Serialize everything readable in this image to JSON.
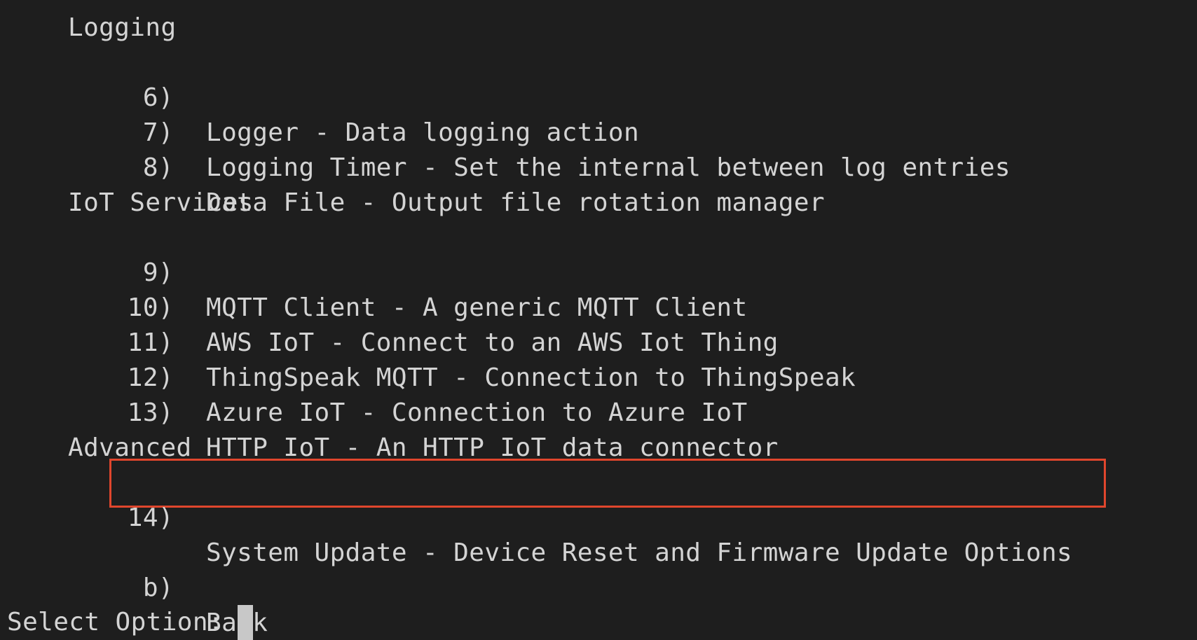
{
  "sections": {
    "logging": "Logging",
    "iot": "IoT Services",
    "advanced": "Advanced"
  },
  "options": [
    {
      "num": "6)",
      "label": "Logger - Data logging action"
    },
    {
      "num": "7)",
      "label": "Logging Timer - Set the internal between log entries"
    },
    {
      "num": "8)",
      "label": "Data File - Output file rotation manager"
    },
    {
      "num": "9)",
      "label": "MQTT Client - A generic MQTT Client"
    },
    {
      "num": "10)",
      "label": "AWS IoT - Connect to an AWS Iot Thing"
    },
    {
      "num": "11)",
      "label": "ThingSpeak MQTT - Connection to ThingSpeak"
    },
    {
      "num": "12)",
      "label": "Azure IoT - Connection to Azure IoT"
    },
    {
      "num": "13)",
      "label": "HTTP IoT - An HTTP IoT data connector"
    },
    {
      "num": "14)",
      "label": "System Update - Device Reset and Firmware Update Options"
    },
    {
      "num": "b)",
      "label": "Back"
    }
  ],
  "prompt": "Select Option:",
  "highlight_color": "#e0462d"
}
